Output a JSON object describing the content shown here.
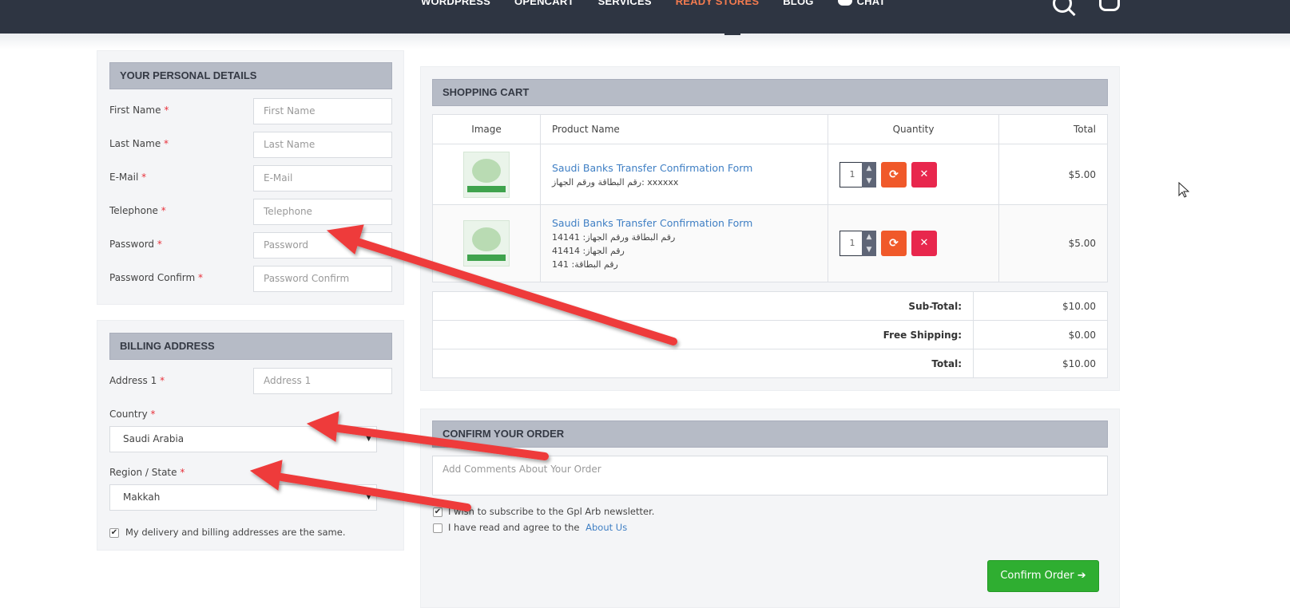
{
  "nav": {
    "items": [
      "WORDPRESS",
      "OPENCART",
      "SERVICES",
      "READY STORES",
      "BLOG",
      "CHAT"
    ]
  },
  "personal": {
    "heading": "YOUR PERSONAL DETAILS",
    "fields": [
      {
        "label": "First Name",
        "placeholder": "First Name"
      },
      {
        "label": "Last Name",
        "placeholder": "Last Name"
      },
      {
        "label": "E-Mail",
        "placeholder": "E-Mail"
      },
      {
        "label": "Telephone",
        "placeholder": "Telephone"
      },
      {
        "label": "Password",
        "placeholder": "Password"
      },
      {
        "label": "Password Confirm",
        "placeholder": "Password Confirm"
      }
    ]
  },
  "billing": {
    "heading": "BILLING ADDRESS",
    "address_label": "Address 1",
    "address_placeholder": "Address 1",
    "country_label": "Country",
    "country_value": "Saudi Arabia",
    "region_label": "Region / State",
    "region_value": "Makkah",
    "same_address": "My delivery and billing addresses are the same."
  },
  "cart": {
    "heading": "SHOPPING CART",
    "columns": [
      "Image",
      "Product Name",
      "Quantity",
      "Total"
    ],
    "rows": [
      {
        "name": "Saudi Banks Transfer Confirmation Form",
        "options": [
          "رقم البطاقة ورقم الجهاز: xxxxxx"
        ],
        "qty": "1",
        "total": "$5.00"
      },
      {
        "name": "Saudi Banks Transfer Confirmation Form",
        "options": [
          "رقم البطاقة ورقم الجهاز: 14141",
          "رقم الجهاز: 41414",
          "رقم البطاقة: 141"
        ],
        "qty": "1",
        "total": "$5.00"
      }
    ],
    "totals": [
      {
        "label": "Sub-Total:",
        "value": "$10.00"
      },
      {
        "label": "Free Shipping:",
        "value": "$0.00"
      },
      {
        "label": "Total:",
        "value": "$10.00"
      }
    ]
  },
  "confirm": {
    "heading": "CONFIRM YOUR ORDER",
    "comments_placeholder": "Add Comments About Your Order",
    "newsletter": "I wish to subscribe to the Gpl Arb newsletter.",
    "agree": "I have read and agree to the",
    "agree_link": "About Us",
    "button": "Confirm Order"
  },
  "colors": {
    "navbar": "#2e3542",
    "active_nav": "#f37b4f",
    "heading_bg": "#b6bbc6",
    "confirm_button": "#2fae31",
    "annotation_arrow": "#ee3b3b"
  }
}
